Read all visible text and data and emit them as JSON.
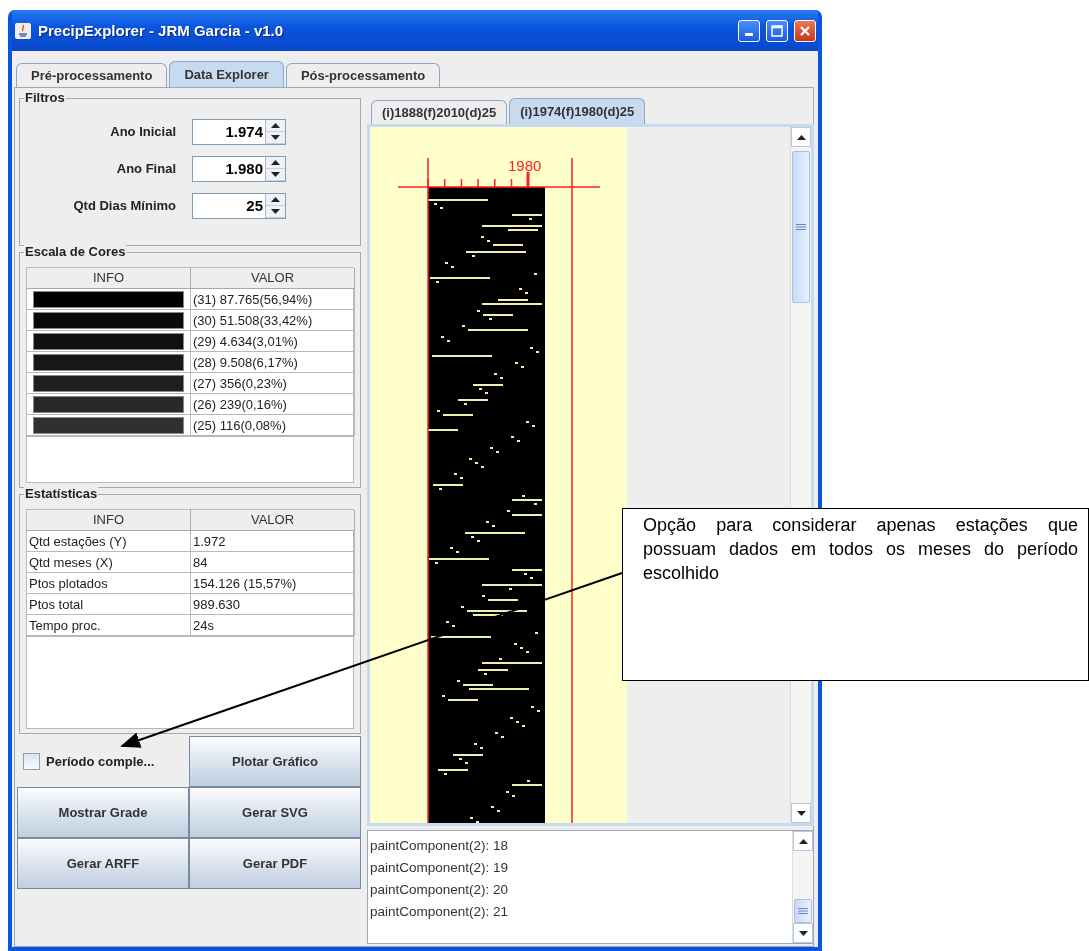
{
  "window": {
    "title": "PrecipExplorer - JRM Garcia - v1.0"
  },
  "tabs": [
    {
      "label": "Pré-processamento",
      "selected": false
    },
    {
      "label": "Data Explorer",
      "selected": true
    },
    {
      "label": "Pós-processamento",
      "selected": false
    }
  ],
  "filters": {
    "title": "Filtros",
    "fields": [
      {
        "label": "Ano Inicial",
        "value": "1.974"
      },
      {
        "label": "Ano Final",
        "value": "1.980"
      },
      {
        "label": "Qtd Dias Mínimo",
        "value": "25"
      }
    ]
  },
  "color_scale": {
    "title": "Escala de Cores",
    "columns": [
      "INFO",
      "VALOR"
    ],
    "rows": [
      {
        "color": "#000000",
        "value": "(31) 87.765(56,94%)"
      },
      {
        "color": "#0a0a0a",
        "value": "(30) 51.508(33,42%)"
      },
      {
        "color": "#101010",
        "value": "(29) 4.634(3,01%)"
      },
      {
        "color": "#171717",
        "value": "(28) 9.508(6,17%)"
      },
      {
        "color": "#1f1f1f",
        "value": "(27) 356(0,23%)"
      },
      {
        "color": "#282828",
        "value": "(26) 239(0,16%)"
      },
      {
        "color": "#303030",
        "value": "(25) 116(0,08%)"
      }
    ]
  },
  "statistics": {
    "title": "Estatísticas",
    "columns": [
      "INFO",
      "VALOR"
    ],
    "rows": [
      {
        "info": "Qtd estações (Y)",
        "value": "1.972"
      },
      {
        "info": "Qtd meses (X)",
        "value": "84"
      },
      {
        "info": "Ptos plotados",
        "value": "154.126 (15,57%)"
      },
      {
        "info": "Ptos total",
        "value": "989.630"
      },
      {
        "info": "Tempo proc.",
        "value": "24s"
      }
    ]
  },
  "period_checkbox": {
    "label": "Período comple...",
    "checked": false
  },
  "buttons": [
    "Plotar Gráfico",
    "Mostrar Grade",
    "Gerar SVG",
    "Gerar ARFF",
    "Gerar PDF"
  ],
  "plot_tabs": [
    {
      "label": "(i)1888(f)2010(d)25",
      "selected": false
    },
    {
      "label": "(i)1974(f)1980(d)25",
      "selected": true
    }
  ],
  "plot": {
    "axis_label": "1980"
  },
  "log": [
    "paintComponent(2): 18",
    "paintComponent(2): 19",
    "paintComponent(2): 20",
    "paintComponent(2): 21"
  ],
  "callout": {
    "text": "Opção para considerar apenas estações que possuam dados em todos os meses do período escolhido"
  }
}
